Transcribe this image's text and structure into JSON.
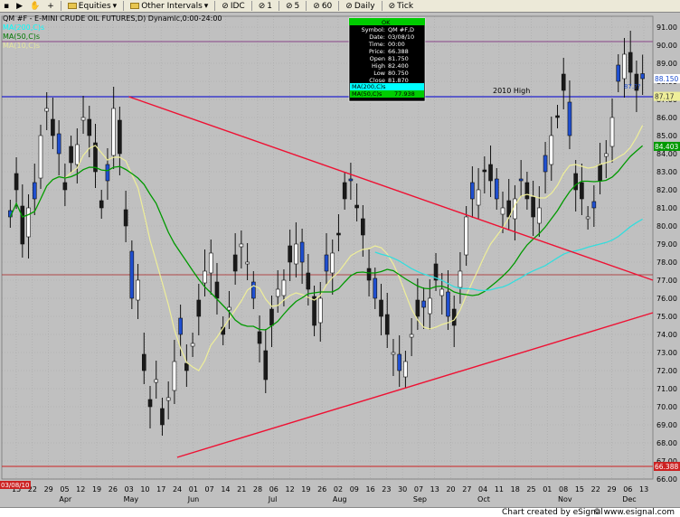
{
  "toolbar": {
    "items": [
      {
        "label": "▪",
        "kind": "marker"
      },
      {
        "label": "▶",
        "kind": "tool"
      },
      {
        "label": "✋",
        "kind": "tool"
      },
      {
        "label": "+",
        "kind": "tool"
      },
      {
        "label": "Equities",
        "kind": "menu"
      },
      {
        "label": "Other Intervals",
        "kind": "menu"
      },
      {
        "label": "IDC",
        "kind": "interval"
      },
      {
        "label": "1",
        "kind": "interval"
      },
      {
        "label": "5",
        "kind": "interval"
      },
      {
        "label": "60",
        "kind": "interval"
      },
      {
        "label": "Daily",
        "kind": "interval"
      },
      {
        "label": "Tick",
        "kind": "interval"
      }
    ]
  },
  "chart_header": {
    "title": "QM #F - E-MINI CRUDE OIL FUTURES,D) Dynamic,0:00-24:00",
    "indicators": [
      "MA(200,C)s",
      "MA(50,C)s",
      "MA(10,C)s"
    ],
    "indicator_colors": [
      "#00ffff",
      "#007700",
      "#e6e6a0"
    ]
  },
  "data_window": {
    "status": "OK",
    "rows": [
      {
        "label": "Symbol:",
        "value": "QM #F,D"
      },
      {
        "label": "Date:",
        "value": "03/08/10"
      },
      {
        "label": "Time:",
        "value": "00:00"
      },
      {
        "label": "Price:",
        "value": "66.388"
      },
      {
        "label": "Open",
        "value": "81.750"
      },
      {
        "label": "High",
        "value": "82.400"
      },
      {
        "label": "Low",
        "value": "80.750"
      },
      {
        "label": "Close",
        "value": "81.870"
      }
    ],
    "ma_rows": [
      {
        "label": "MA(200,C)s",
        "value": "",
        "color": "#00ffff"
      },
      {
        "label": "MA(50,C)s",
        "value": "77.938",
        "color": "#00cc00"
      }
    ]
  },
  "annotations": {
    "high_label": "2010 High",
    "cursor_date": "03/08/10",
    "last_price_label": "88.150",
    "ma10_label": "87.17",
    "ma50_label": "84.403",
    "cursor_price_label": "66.388",
    "ma10_small": "87.??"
  },
  "footer": {
    "credit": "Chart created by eSignal",
    "copy": "© www.esignal.com"
  },
  "colors": {
    "background": "#c0c0c0",
    "up_bar": "#ffffff",
    "down_bar": "#1a1a1a",
    "blue_bar": "#1f4fd0",
    "ma10": "#eeee99",
    "ma50": "#009900",
    "ma200": "#33dddd",
    "trendline": "#ee1133",
    "high_line": "#2222cc",
    "grid": "#a8a8a8"
  },
  "chart_data": {
    "type": "candlestick",
    "title": "QM #F - E-MINI CRUDE OIL FUTURES,D) Dynamic,0:00-24:00",
    "y_ticks": [
      66,
      67,
      68,
      69,
      70,
      71,
      72,
      73,
      74,
      75,
      76,
      77,
      78,
      79,
      80,
      81,
      82,
      83,
      84,
      85,
      86,
      87,
      88,
      89,
      90,
      91
    ],
    "ylim": [
      66,
      92
    ],
    "x_ticks": [
      "15",
      "22",
      "29",
      "05",
      "12",
      "19",
      "26",
      "03",
      "10",
      "17",
      "24",
      "01",
      "07",
      "14",
      "21",
      "28",
      "06",
      "12",
      "19",
      "26",
      "02",
      "09",
      "16",
      "23",
      "30",
      "07",
      "13",
      "20",
      "27",
      "04",
      "11",
      "18",
      "25",
      "01",
      "08",
      "15",
      "22",
      "29",
      "06",
      "13"
    ],
    "month_labels": [
      "Apr",
      "May",
      "Jun",
      "Jul",
      "Aug",
      "Sep",
      "Oct",
      "Nov",
      "Dec"
    ],
    "horizontal_levels": {
      "2010 High": 87.15,
      "purple_top": 90.2,
      "red_low": 66.7,
      "red_mid": 77.3
    },
    "trendlines": [
      {
        "name": "",
        "from": {
          "x": "03 May",
          "y": 87.15
        },
        "to": {
          "x": "13 Dec",
          "y": 77.0
        }
      },
      {
        "name": "",
        "from": {
          "x": "24 May",
          "y": 67.2
        },
        "to": {
          "x": "13 Dec",
          "y": 75.2
        }
      }
    ],
    "close_series": [
      80.5,
      82.0,
      79.0,
      81.0,
      81.5,
      85.0,
      86.5,
      85.0,
      84.0,
      82.0,
      83.5,
      84.5,
      86.0,
      85.0,
      83.0,
      81.0,
      82.5,
      86.5,
      84.0,
      80.0,
      76.0,
      77.0,
      72.0,
      70.0,
      71.5,
      69.0,
      70.5,
      72.5,
      74.0,
      72.0,
      73.5,
      75.0,
      77.5,
      78.5,
      76.0,
      74.0,
      75.5,
      77.5,
      79.0,
      78.0,
      76.0,
      73.5,
      71.5,
      74.5,
      76.5,
      77.0,
      78.0,
      79.0,
      78.0,
      76.5,
      74.5,
      76.0,
      77.5,
      78.5,
      79.5,
      81.5,
      82.5,
      81.0,
      79.5,
      77.0,
      76.0,
      75.0,
      74.0,
      73.0,
      72.0,
      72.5,
      74.0,
      75.0,
      75.5,
      76.0,
      77.0,
      76.5,
      75.0,
      74.5,
      77.5,
      80.5,
      81.5,
      82.0,
      83.0,
      82.5,
      81.5,
      81.0,
      80.5,
      81.5,
      82.5,
      81.5,
      80.5,
      81.0,
      83.0,
      85.0,
      86.0,
      87.5,
      85.0,
      82.0,
      81.5,
      80.5,
      81.0,
      82.5,
      84.0,
      86.0,
      88.0,
      89.5,
      88.5,
      87.5,
      88.15
    ],
    "series": [
      {
        "name": "MA(10,C)s",
        "color": "#eeee99"
      },
      {
        "name": "MA(50,C)s",
        "color": "#009900",
        "last": 84.403
      },
      {
        "name": "MA(200,C)s",
        "color": "#33dddd"
      }
    ]
  }
}
